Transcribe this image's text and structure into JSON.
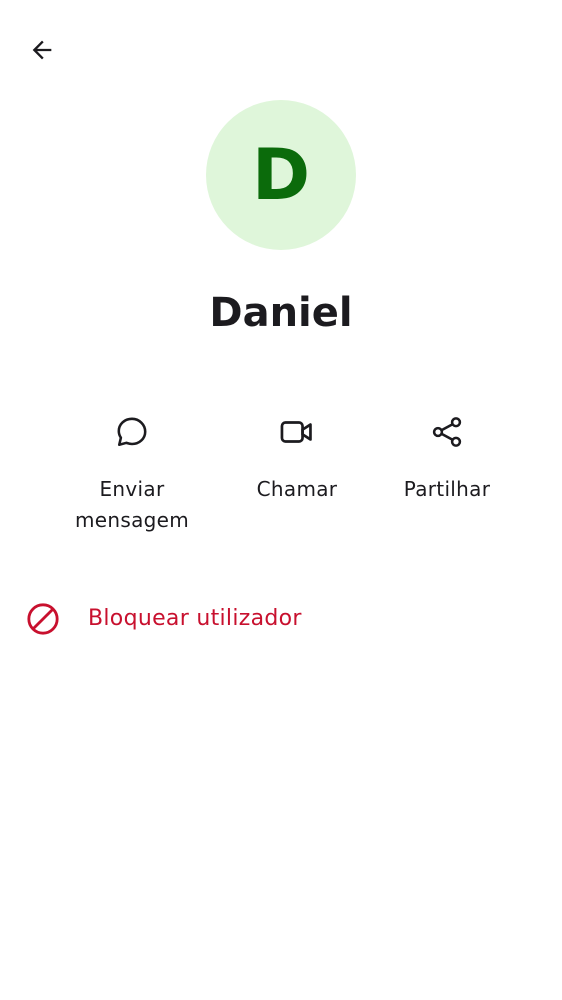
{
  "header": {
    "back_icon": "arrow-left-icon"
  },
  "contact": {
    "avatar_letter": "D",
    "avatar_bg": "#dff6da",
    "avatar_fg": "#0b6b0b",
    "name": "Daniel"
  },
  "actions": [
    {
      "icon": "chat-bubble-icon",
      "label": "Enviar mensagem"
    },
    {
      "icon": "video-camera-icon",
      "label": "Chamar"
    },
    {
      "icon": "share-icon",
      "label": "Partilhar"
    }
  ],
  "block": {
    "icon": "block-icon",
    "label": "Bloquear utilizador",
    "color": "#c8102e"
  }
}
